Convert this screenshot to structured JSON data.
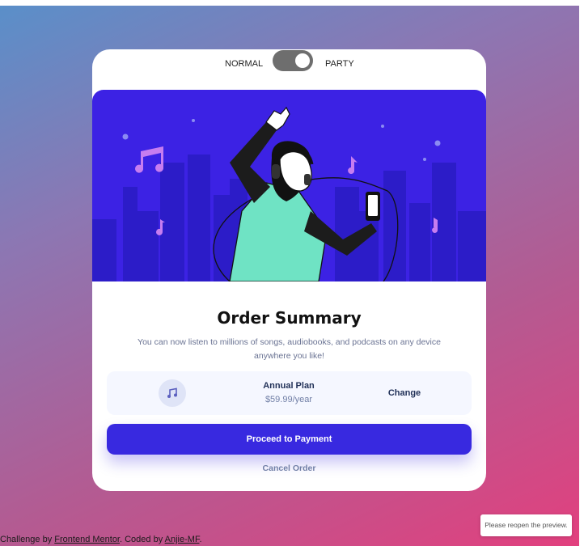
{
  "toggle": {
    "left_label": "NORMAL",
    "right_label": "PARTY",
    "state": "party"
  },
  "hero": {
    "icon": "dancing-person-with-headphones-illustration"
  },
  "order": {
    "title": "Order Summary",
    "description": "You can now listen to millions of songs, audiobooks, and podcasts on any device anywhere you like!",
    "plan_icon": "music-note-icon",
    "plan_name": "Annual Plan",
    "plan_price": "$59.99/year",
    "change_label": "Change",
    "pay_label": "Proceed to Payment",
    "cancel_label": "Cancel Order"
  },
  "attribution": {
    "prefix": "Challenge by ",
    "link1": "Frontend Mentor",
    "middle": ". Coded by ",
    "link2": "Anjie-MF",
    "suffix": "."
  },
  "toast": {
    "text": "Please reopen the preview."
  },
  "colors": {
    "accent": "#3829e0",
    "hero_bg": "#3c22e4",
    "title": "#1f2f56",
    "muted": "#717fa6"
  }
}
